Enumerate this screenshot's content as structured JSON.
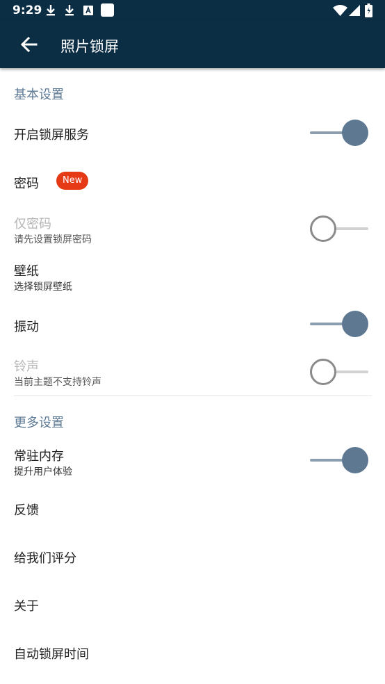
{
  "status_bar": {
    "time": "9:29",
    "icons": [
      "download-icon",
      "download-icon",
      "font-icon",
      "square-icon",
      "wifi-icon",
      "signal-icon",
      "battery-icon"
    ]
  },
  "app_bar": {
    "title": "照片锁屏",
    "back_icon": "arrow-left-icon"
  },
  "sections": {
    "basic": {
      "header": "基本设置"
    },
    "more": {
      "header": "更多设置"
    }
  },
  "items": {
    "lock_service": {
      "title": "开启锁屏服务",
      "toggle": true
    },
    "password": {
      "title": "密码",
      "badge": "New"
    },
    "password_only": {
      "title": "仅密码",
      "subtitle": "请先设置锁屏密码",
      "toggle": false,
      "disabled": true
    },
    "wallpaper": {
      "title": "壁纸",
      "subtitle": "选择锁屏壁纸"
    },
    "vibrate": {
      "title": "振动",
      "toggle": true
    },
    "ringtone": {
      "title": "铃声",
      "subtitle": "当前主题不支持铃声",
      "toggle": false,
      "disabled": true
    },
    "resident_memory": {
      "title": "常驻内存",
      "subtitle": "提升用户体验",
      "toggle": true
    },
    "feedback": {
      "title": "反馈"
    },
    "rate_us": {
      "title": "给我们评分"
    },
    "about": {
      "title": "关于"
    },
    "auto_lock_time": {
      "title": "自动锁屏时间"
    }
  },
  "colors": {
    "app_bar": "#0b2e45",
    "section_header": "#5e7a95",
    "switch_thumb_on": "#5f7892",
    "switch_track_on": "#8c9eae",
    "badge": "#e63a16"
  }
}
